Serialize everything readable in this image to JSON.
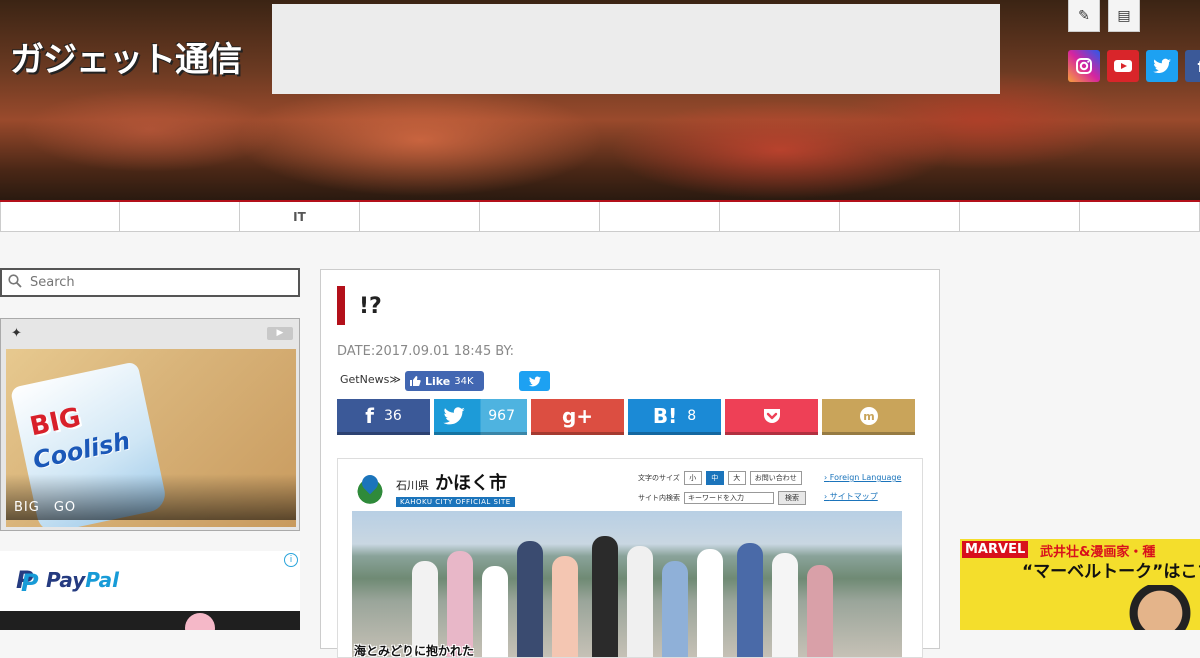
{
  "header": {
    "logo_text": "ガジェット通信",
    "tool_icons": [
      "pencil-icon",
      "document-icon"
    ],
    "social_icons": [
      {
        "name": "instagram-icon",
        "color": "#c13584"
      },
      {
        "name": "youtube-icon",
        "color": "#d9252a"
      },
      {
        "name": "twitter-icon",
        "color": "#1da1f2"
      },
      {
        "name": "facebook-icon",
        "color": "#3b5998"
      }
    ]
  },
  "nav": {
    "items": [
      "",
      "",
      "IT",
      "",
      "",
      "",
      "",
      "",
      "",
      ""
    ]
  },
  "sidebar": {
    "search_placeholder": "Search",
    "widget_star": "✦",
    "widget_image_text_big": "BIG",
    "widget_image_text_name": "Coolish",
    "widget_caption": "BIG　GO",
    "paypal_word_1": "Pay",
    "paypal_word_2": "Pal",
    "ad_info": "i"
  },
  "article": {
    "title": "!?",
    "date_label": "DATE:2017.09.01 18:45",
    "by_label": "BY:",
    "getnews": "GetNews≫",
    "fb_like_label": "Like",
    "fb_like_count": "34K",
    "share_buttons": [
      {
        "name": "facebook-share",
        "icon": "f",
        "count": "36",
        "color": "#3b5998"
      },
      {
        "name": "twitter-share",
        "icon": "🐦",
        "count": "967",
        "color": "#2ea3d6"
      },
      {
        "name": "googleplus-share",
        "icon": "g+",
        "count": "",
        "color": "#dc4e41"
      },
      {
        "name": "hatena-share",
        "icon": "B!",
        "count": "8",
        "color": "#1b8ad6"
      },
      {
        "name": "pocket-share",
        "icon": "❯",
        "count": "",
        "color": "#ee4056"
      },
      {
        "name": "mixi-share",
        "icon": "m",
        "count": "",
        "color": "#c9a45a"
      }
    ],
    "embed": {
      "prefecture": "石川県",
      "city": "かほく市",
      "city_en": "KAHOKU CITY OFFICIAL SITE",
      "font_size_label": "文字のサイズ",
      "size_small": "小",
      "size_medium": "中",
      "size_large": "大",
      "contact_label": "お問い合わせ",
      "site_search_label": "サイト内検索",
      "keyword_placeholder": "キーワードを入力",
      "search_button": "検索",
      "foreign_language": "Foreign Language",
      "sitemap": "サイトマップ",
      "photo_caption": "海とみどりに抱かれた"
    }
  },
  "right_ad": {
    "marvel_logo": "MARVEL",
    "line1": "武井壮&漫画家・種",
    "line2": "“マーベルトーク”はこち"
  }
}
